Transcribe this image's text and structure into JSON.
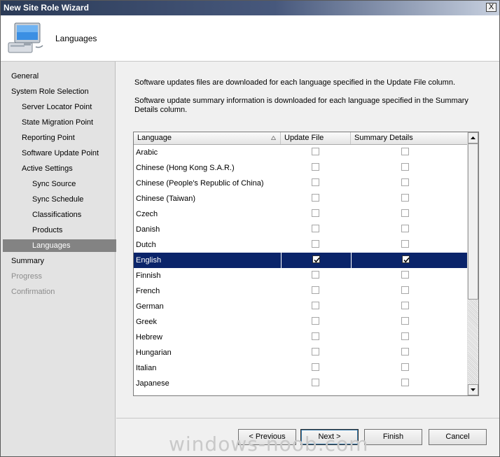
{
  "window": {
    "title": "New Site Role Wizard",
    "close_label": "X"
  },
  "header": {
    "title": "Languages",
    "icon": "computer-icon"
  },
  "nav": {
    "items": [
      {
        "label": "General",
        "state": "normal"
      },
      {
        "label": "System Role Selection",
        "state": "normal"
      },
      {
        "label": "Server Locator Point",
        "state": "normal"
      },
      {
        "label": "State Migration Point",
        "state": "normal"
      },
      {
        "label": "Reporting Point",
        "state": "normal"
      },
      {
        "label": "Software Update Point",
        "state": "normal"
      },
      {
        "label": "Active Settings",
        "state": "normal"
      },
      {
        "label": "Sync Source",
        "state": "normal"
      },
      {
        "label": "Sync Schedule",
        "state": "normal"
      },
      {
        "label": "Classifications",
        "state": "normal"
      },
      {
        "label": "Products",
        "state": "normal"
      },
      {
        "label": "Languages",
        "state": "selected"
      },
      {
        "label": "Summary",
        "state": "normal"
      },
      {
        "label": "Progress",
        "state": "disabled"
      },
      {
        "label": "Confirmation",
        "state": "disabled"
      }
    ]
  },
  "content": {
    "description_1": "Software updates files are downloaded for each language specified in the Update File column.",
    "description_2": "Software update summary information is downloaded for each language specified in the Summary Details column.",
    "table": {
      "columns": [
        "Language",
        "Update File",
        "Summary Details"
      ],
      "rows": [
        {
          "language": "Arabic",
          "update_file": false,
          "summary_details": false
        },
        {
          "language": "Chinese (Hong Kong S.A.R.)",
          "update_file": false,
          "summary_details": false
        },
        {
          "language": "Chinese (People's Republic of China)",
          "update_file": false,
          "summary_details": false
        },
        {
          "language": "Chinese (Taiwan)",
          "update_file": false,
          "summary_details": false
        },
        {
          "language": "Czech",
          "update_file": false,
          "summary_details": false
        },
        {
          "language": "Danish",
          "update_file": false,
          "summary_details": false
        },
        {
          "language": "Dutch",
          "update_file": false,
          "summary_details": false
        },
        {
          "language": "English",
          "update_file": true,
          "summary_details": true,
          "selected": true
        },
        {
          "language": "Finnish",
          "update_file": false,
          "summary_details": false
        },
        {
          "language": "French",
          "update_file": false,
          "summary_details": false
        },
        {
          "language": "German",
          "update_file": false,
          "summary_details": false
        },
        {
          "language": "Greek",
          "update_file": false,
          "summary_details": false
        },
        {
          "language": "Hebrew",
          "update_file": false,
          "summary_details": false
        },
        {
          "language": "Hungarian",
          "update_file": false,
          "summary_details": false
        },
        {
          "language": "Italian",
          "update_file": false,
          "summary_details": false
        },
        {
          "language": "Japanese",
          "update_file": false,
          "summary_details": false
        }
      ]
    }
  },
  "buttons": {
    "previous": "< Previous",
    "next": "Next >",
    "finish": "Finish",
    "cancel": "Cancel"
  },
  "watermark": "windows-noob.com"
}
